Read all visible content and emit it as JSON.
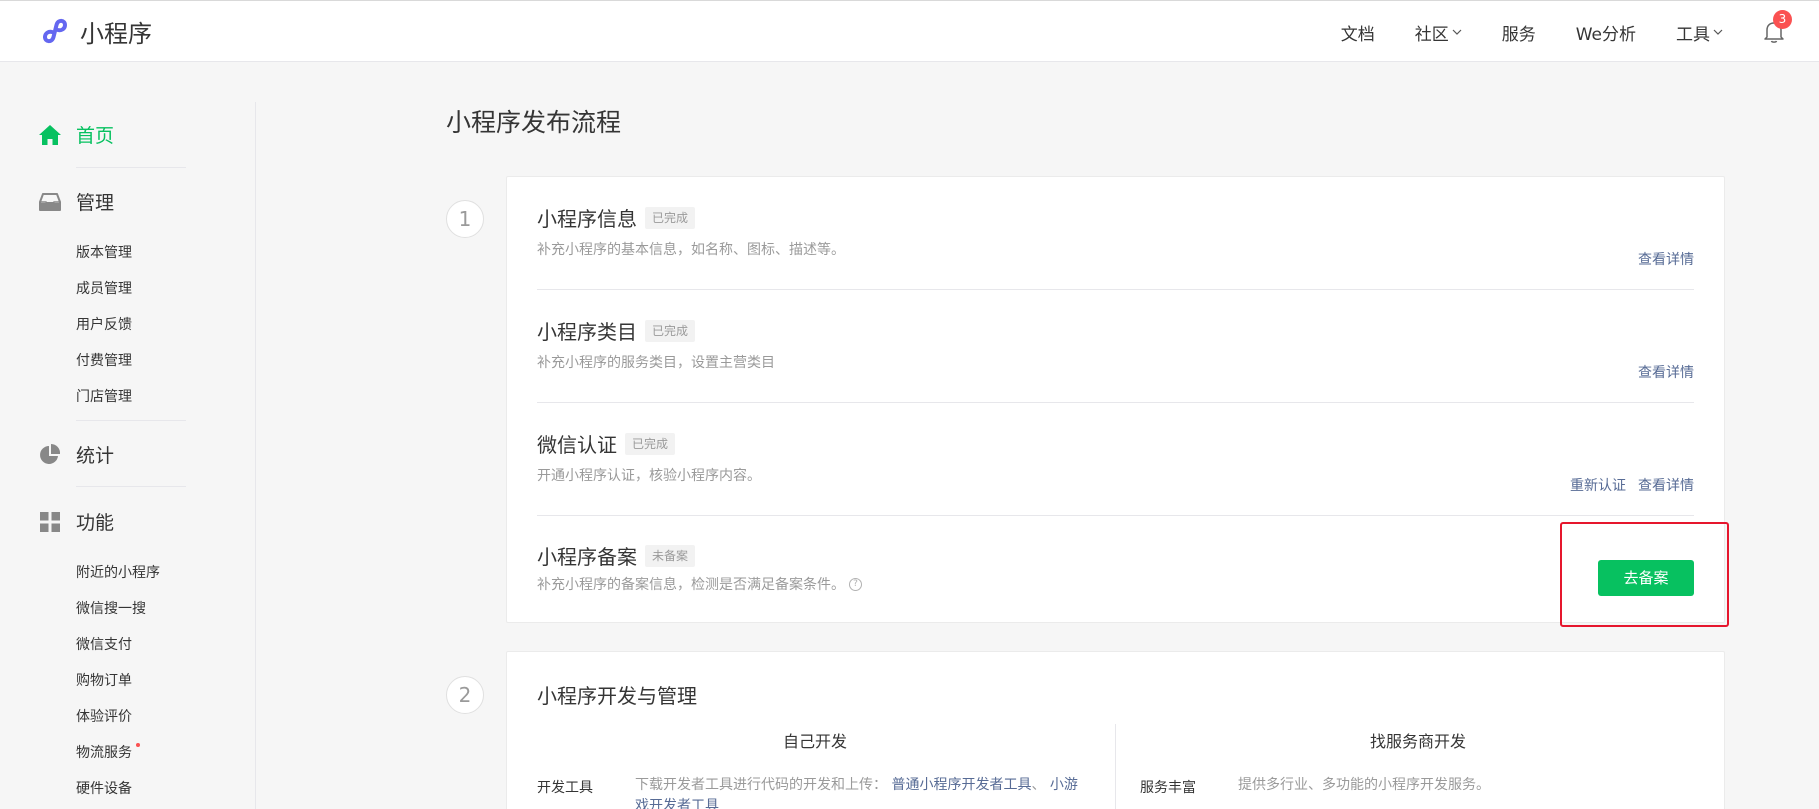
{
  "header": {
    "brand": "小程序",
    "nav": [
      {
        "label": "文档",
        "dropdown": false
      },
      {
        "label": "社区",
        "dropdown": true
      },
      {
        "label": "服务",
        "dropdown": false
      },
      {
        "label": "We分析",
        "dropdown": false
      },
      {
        "label": "工具",
        "dropdown": true
      }
    ],
    "notification_count": "3"
  },
  "sidebar": {
    "sections": [
      {
        "label": "首页",
        "icon": "home-icon",
        "active": true
      },
      {
        "label": "管理",
        "icon": "inbox-icon",
        "items": [
          "版本管理",
          "成员管理",
          "用户反馈",
          "付费管理",
          "门店管理"
        ]
      },
      {
        "label": "统计",
        "icon": "pie-chart-icon"
      },
      {
        "label": "功能",
        "icon": "grid-icon",
        "items": [
          "附近的小程序",
          "微信搜一搜",
          "微信支付",
          "购物订单",
          "体验评价",
          "物流服务",
          "硬件设备"
        ]
      }
    ]
  },
  "main": {
    "title": "小程序发布流程",
    "step1": {
      "number": "1",
      "rows": [
        {
          "title": "小程序信息",
          "tag": "已完成",
          "desc": "补充小程序的基本信息，如名称、图标、描述等。",
          "actions": [
            "查看详情"
          ]
        },
        {
          "title": "小程序类目",
          "tag": "已完成",
          "desc": "补充小程序的服务类目，设置主营类目",
          "actions": [
            "查看详情"
          ]
        },
        {
          "title": "微信认证",
          "tag": "已完成",
          "desc": "开通小程序认证，核验小程序内容。",
          "actions": [
            "重新认证",
            "查看详情"
          ]
        },
        {
          "title": "小程序备案",
          "tag": "未备案",
          "desc": "补充小程序的备案信息，检测是否满足备案条件。",
          "button": "去备案"
        }
      ]
    },
    "step2": {
      "number": "2",
      "title": "小程序开发与管理",
      "left": {
        "head": "自己开发",
        "key": "开发工具",
        "desc": "下载开发者工具进行代码的开发和上传：",
        "link1": "普通小程序开发者工具",
        "sep": "、",
        "link2": "小游戏开发者工具"
      },
      "right": {
        "head": "找服务商开发",
        "key": "服务丰富",
        "desc": "提供多行业、多功能的小程序开发服务。"
      }
    }
  },
  "colors": {
    "accent": "#07c160",
    "link": "#576b95",
    "highlight": "#e6162d",
    "badge": "#fa5151"
  }
}
